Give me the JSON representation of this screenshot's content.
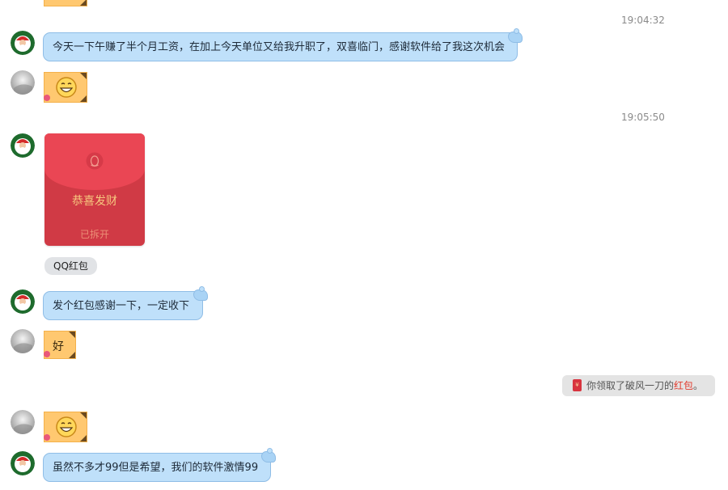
{
  "messages": {
    "time_1": "19:04:32",
    "msg_1": "今天一下午赚了半个月工资，在加上今天单位又给我升职了，双喜临门，感谢软件给了我这次机会",
    "time_2": "19:05:50",
    "red_packet": {
      "title": "恭喜发财",
      "status": "已拆开"
    },
    "red_packet_tag": "QQ红包",
    "msg_2": "发个红包感谢一下，一定收下",
    "sticker_text": "好",
    "notice": {
      "prefix": "你领取了破风一刀的",
      "highlight": "红包",
      "suffix": "。",
      "icon": "¥"
    },
    "msg_3": "虽然不多才99但是希望，我们的软件激情99"
  },
  "colors": {
    "bubble": "#bfe0fa",
    "red_packet": "#d03a45",
    "red_packet_text": "#f7c97f",
    "notice_highlight": "#e23a2d",
    "sticker": "#ffc870"
  },
  "icons": {
    "santa_avatar": "santa-avatar",
    "gray_avatar": "gray-avatar",
    "grin": "grin-face-sticker",
    "qq_penguin": "penguin-icon"
  }
}
